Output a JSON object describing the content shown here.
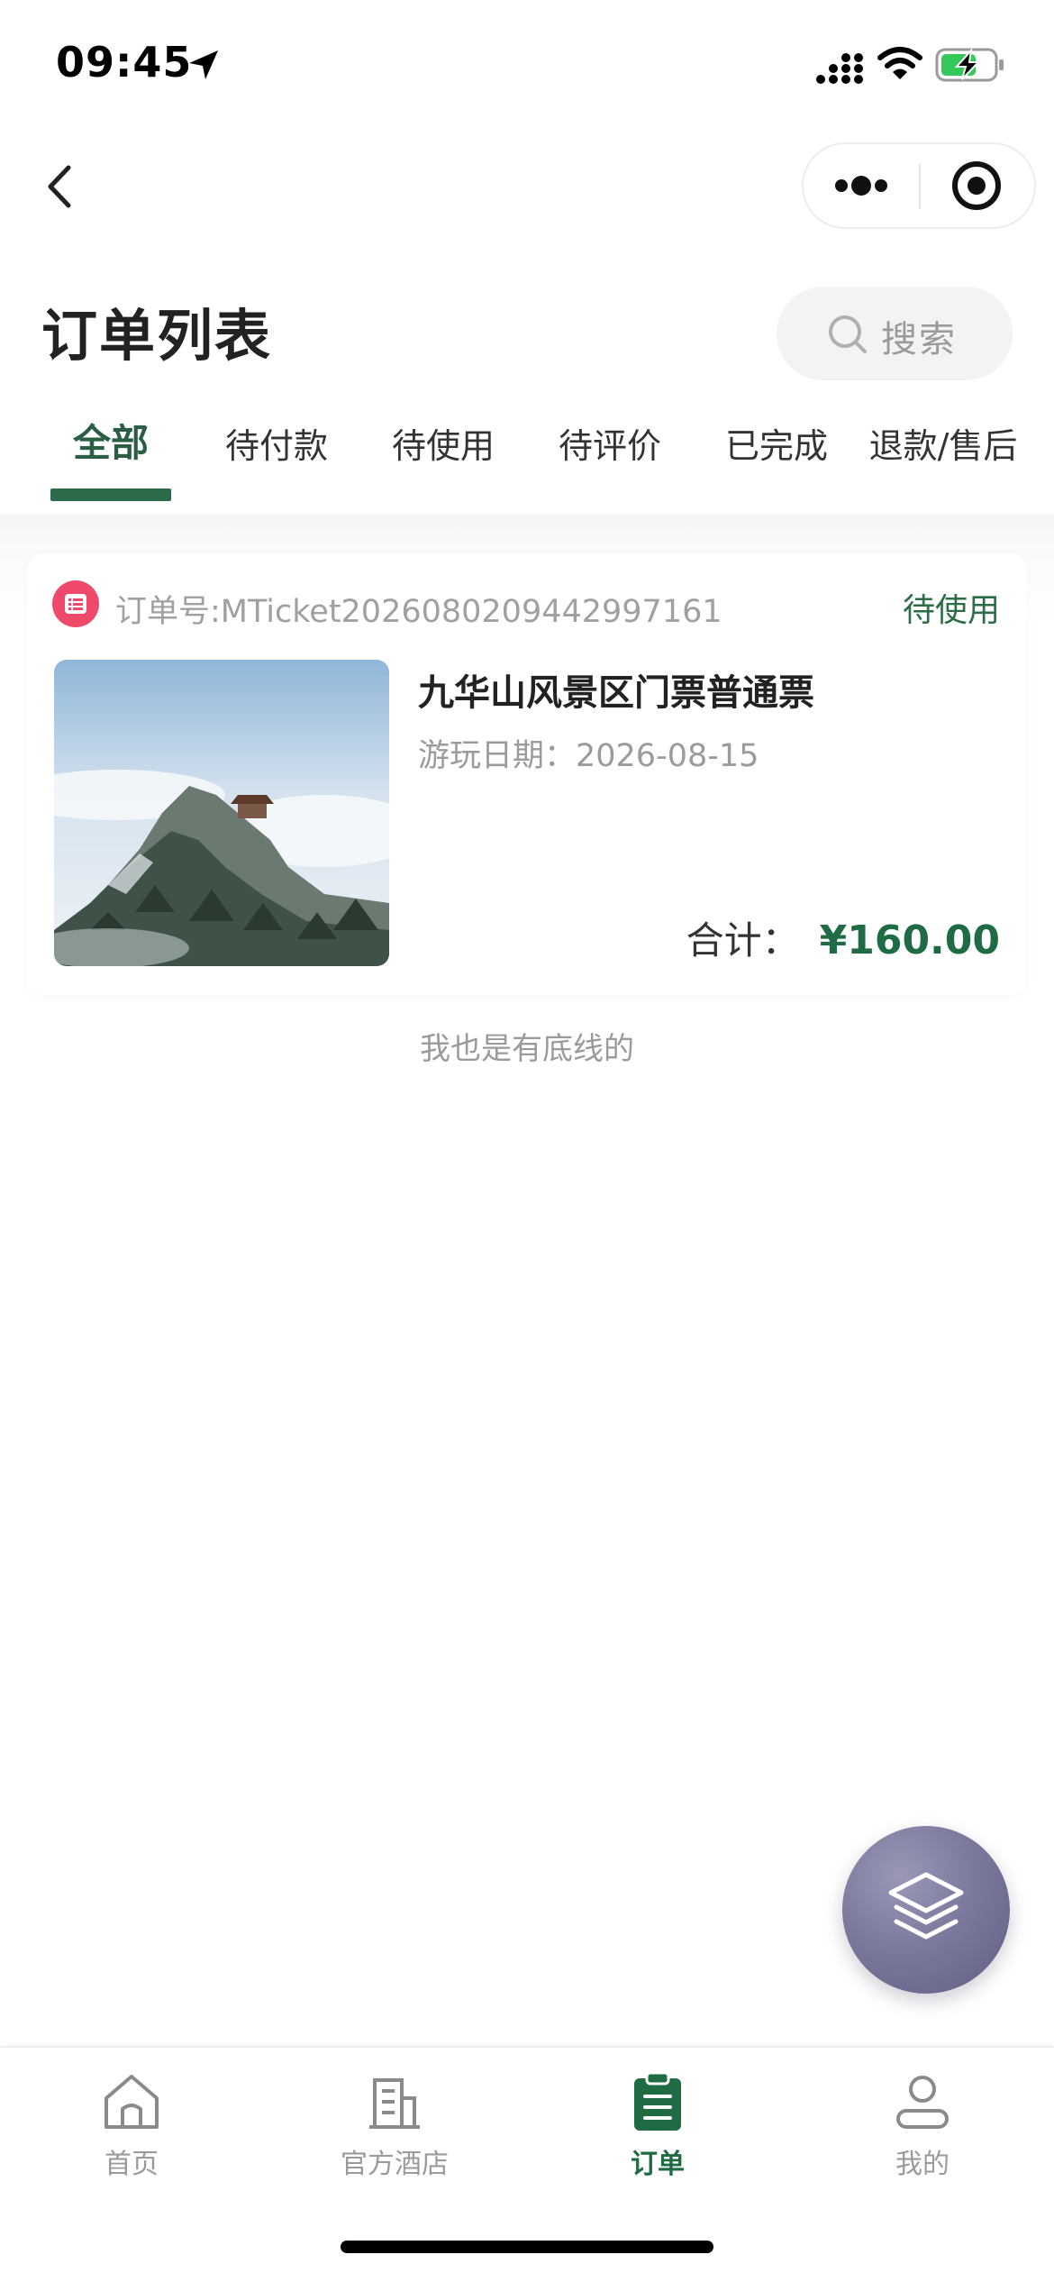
{
  "status_bar": {
    "time": "09:45"
  },
  "header": {
    "title": "订单列表",
    "search_placeholder": "搜索"
  },
  "tabs": [
    {
      "label": "全部",
      "active": true
    },
    {
      "label": "待付款",
      "active": false
    },
    {
      "label": "待使用",
      "active": false
    },
    {
      "label": "待评价",
      "active": false
    },
    {
      "label": "已完成",
      "active": false
    },
    {
      "label": "退款/售后",
      "active": false
    }
  ],
  "orders": [
    {
      "order_no": "订单号:MTicket2026080209442997161",
      "status": "待使用",
      "product_name": "九华山风景区门票普通票",
      "visit_date": "游玩日期：2026-08-15",
      "total_label": "合计：",
      "total_value": "¥160.00"
    }
  ],
  "list_footer": "我也是有底线的",
  "tab_bar": [
    {
      "label": "首页",
      "icon": "home-icon",
      "active": false
    },
    {
      "label": "官方酒店",
      "icon": "building-icon",
      "active": false
    },
    {
      "label": "订单",
      "icon": "clipboard-icon",
      "active": true
    },
    {
      "label": "我的",
      "icon": "user-icon",
      "active": false
    }
  ],
  "colors": {
    "accent": "#1f6b43",
    "status": "#2b6e45",
    "order_icon": "#ef4a6b",
    "fab": "#7c7a9c"
  }
}
